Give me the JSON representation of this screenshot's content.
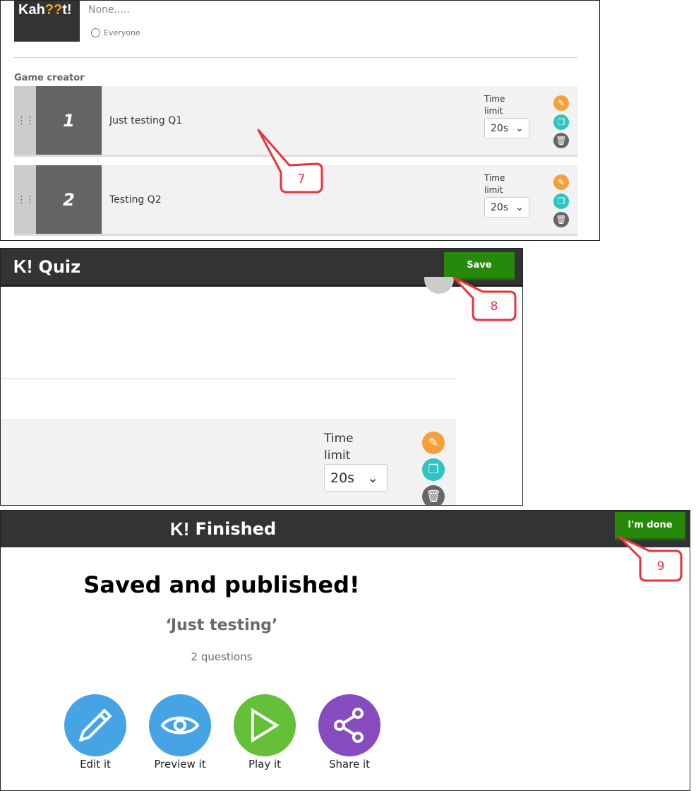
{
  "panel1": {
    "logo_text": "Kah??t!",
    "description": "None.....",
    "visibility": "Everyone",
    "section_title": "Game creator",
    "questions": [
      {
        "number": "1",
        "text": "Just testing Q1",
        "time_label": "Time limit",
        "time_value": "20s"
      },
      {
        "number": "2",
        "text": "Testing Q2",
        "time_label": "Time limit",
        "time_value": "20s"
      }
    ]
  },
  "panel2": {
    "logo": "K!",
    "title": "Quiz",
    "save_label": "Save",
    "time_label": "Time limit",
    "time_value": "20s"
  },
  "panel3": {
    "logo": "K!",
    "title": "Finished",
    "done_label": "I'm done",
    "heading": "Saved and published!",
    "quiz_name": "‘Just testing’",
    "question_count": "2 questions",
    "actions": [
      {
        "label": "Edit it",
        "color": "#46a3e4"
      },
      {
        "label": "Preview it",
        "color": "#46a3e4"
      },
      {
        "label": "Play it",
        "color": "#66bf39"
      },
      {
        "label": "Share it",
        "color": "#864cbf"
      }
    ]
  },
  "callouts": [
    "7",
    "8",
    "9"
  ],
  "colors": {
    "edit": "#f5a03a",
    "duplicate": "#2ec4c4",
    "delete": "#666666",
    "callout": "#e8333a"
  }
}
